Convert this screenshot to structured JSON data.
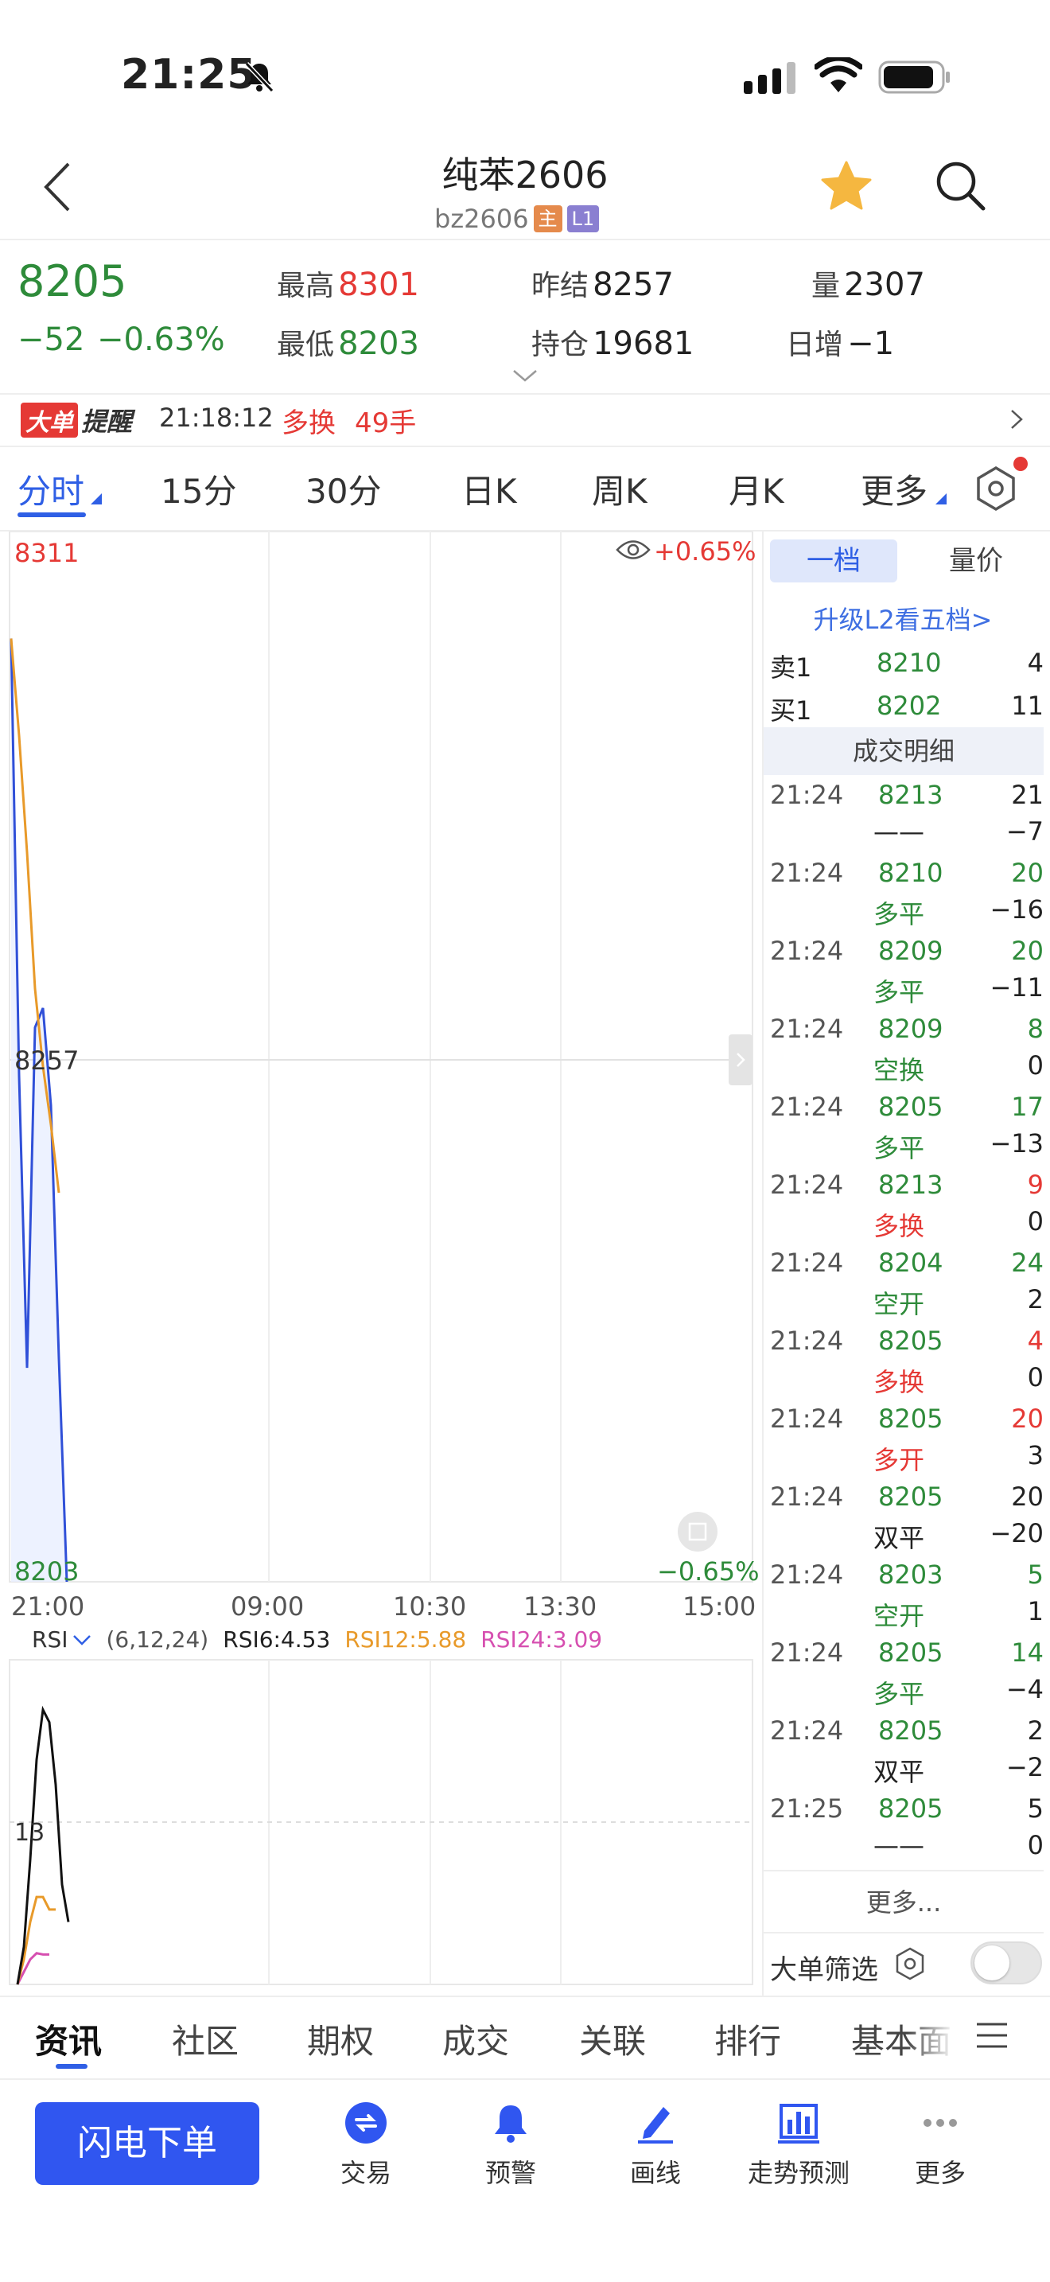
{
  "status_bar": {
    "time": "21:25"
  },
  "header": {
    "title": "纯苯2606",
    "code": "bz2606",
    "tag_main": "主",
    "tag_level": "L1"
  },
  "quote": {
    "last": "8205",
    "change": "−52",
    "change_pct": "−0.63%",
    "high_label": "最高",
    "high": "8301",
    "low_label": "最低",
    "low": "8203",
    "prev_settle_label": "昨结",
    "prev_settle": "8257",
    "open_interest_label": "持仓",
    "open_interest": "19681",
    "volume_label": "量",
    "volume": "2307",
    "daily_inc_label": "日增",
    "daily_inc": "−1"
  },
  "big_order": {
    "badge1": "大单",
    "badge2": "提醒",
    "time": "21:18:12",
    "type": "多换",
    "qty": "49手"
  },
  "period_tabs": [
    "分时",
    "15分",
    "30分",
    "日K",
    "周K",
    "月K",
    "更多"
  ],
  "chart": {
    "high_label": "8311",
    "mid_label": "8257",
    "low_label": "8203",
    "pct_high": "+0.65%",
    "pct_low": "−0.65%",
    "time_labels": [
      "21:00",
      "09:00",
      "10:30",
      "13:30",
      "15:00"
    ],
    "rsi": {
      "name": "RSI",
      "params": "(6,12,24)",
      "rsi6": "RSI6:4.53",
      "rsi12": "RSI12:5.88",
      "rsi24": "RSI24:3.09",
      "mid_label": "13"
    }
  },
  "chart_data": {
    "type": "line",
    "title": "",
    "ylim": [
      8203,
      8311
    ],
    "x_ticks": [
      "21:00",
      "09:00",
      "10:30",
      "13:30",
      "15:00"
    ],
    "series": [
      {
        "name": "price",
        "color": "#3050d8",
        "values": [
          8300,
          8255,
          8225,
          8260,
          8262,
          8252,
          8226,
          8203
        ]
      },
      {
        "name": "avg",
        "color": "#e89a2a",
        "values": [
          8300,
          8290,
          8278,
          8264,
          8256,
          8250,
          8243
        ]
      }
    ],
    "rsi": {
      "colors": {
        "rsi6": "#111111",
        "rsi12": "#e89a2a",
        "rsi24": "#d64fb0"
      },
      "rsi6": [
        0,
        3,
        10,
        18,
        22,
        21,
        16,
        8,
        5
      ],
      "rsi12": [
        0,
        2,
        5,
        7,
        7,
        6,
        6
      ],
      "rsi24": [
        0,
        1,
        2,
        2.5,
        2.4,
        2.4
      ]
    }
  },
  "order_book": {
    "tab1": "一档",
    "tab2": "量价",
    "upgrade": "升级L2看五档>",
    "sell1": {
      "label": "卖1",
      "price": "8210",
      "qty": "4"
    },
    "buy1": {
      "label": "买1",
      "price": "8202",
      "qty": "11"
    },
    "trades_title": "成交明细",
    "trades": [
      {
        "time": "21:24",
        "price": "8213",
        "vol": "21",
        "type": "——",
        "chg": "−7",
        "vol_color": "dark",
        "type_color": "dark"
      },
      {
        "time": "21:24",
        "price": "8210",
        "vol": "20",
        "type": "多平",
        "chg": "−16",
        "vol_color": "green",
        "type_color": "green"
      },
      {
        "time": "21:24",
        "price": "8209",
        "vol": "20",
        "type": "多平",
        "chg": "−11",
        "vol_color": "green",
        "type_color": "green"
      },
      {
        "time": "21:24",
        "price": "8209",
        "vol": "8",
        "type": "空换",
        "chg": "0",
        "vol_color": "green",
        "type_color": "green"
      },
      {
        "time": "21:24",
        "price": "8205",
        "vol": "17",
        "type": "多平",
        "chg": "−13",
        "vol_color": "green",
        "type_color": "green"
      },
      {
        "time": "21:24",
        "price": "8213",
        "vol": "9",
        "type": "多换",
        "chg": "0",
        "vol_color": "red",
        "type_color": "red"
      },
      {
        "time": "21:24",
        "price": "8204",
        "vol": "24",
        "type": "空开",
        "chg": "2",
        "vol_color": "green",
        "type_color": "green"
      },
      {
        "time": "21:24",
        "price": "8205",
        "vol": "4",
        "type": "多换",
        "chg": "0",
        "vol_color": "red",
        "type_color": "red"
      },
      {
        "time": "21:24",
        "price": "8205",
        "vol": "20",
        "type": "多开",
        "chg": "3",
        "vol_color": "red",
        "type_color": "red"
      },
      {
        "time": "21:24",
        "price": "8205",
        "vol": "20",
        "type": "双平",
        "chg": "−20",
        "vol_color": "dark",
        "type_color": "dark"
      },
      {
        "time": "21:24",
        "price": "8203",
        "vol": "5",
        "type": "空开",
        "chg": "1",
        "vol_color": "green",
        "type_color": "green"
      },
      {
        "time": "21:24",
        "price": "8205",
        "vol": "14",
        "type": "多平",
        "chg": "−4",
        "vol_color": "green",
        "type_color": "green"
      },
      {
        "time": "21:24",
        "price": "8205",
        "vol": "2",
        "type": "双平",
        "chg": "−2",
        "vol_color": "dark",
        "type_color": "dark"
      },
      {
        "time": "21:25",
        "price": "8205",
        "vol": "5",
        "type": "——",
        "chg": "0",
        "vol_color": "dark",
        "type_color": "dark"
      }
    ],
    "more": "更多...",
    "filter_label": "大单筛选",
    "filter_on": false
  },
  "info_tabs": [
    "资讯",
    "社区",
    "期权",
    "成交",
    "关联",
    "排行",
    "基本面"
  ],
  "toolbar": {
    "flash_order": "闪电下单",
    "items": [
      {
        "label": "交易",
        "icon": "trade-icon"
      },
      {
        "label": "预警",
        "icon": "bell-icon"
      },
      {
        "label": "画线",
        "icon": "draw-line-icon"
      },
      {
        "label": "走势预测",
        "icon": "forecast-icon"
      },
      {
        "label": "更多",
        "icon": "more-icon"
      }
    ]
  },
  "colors": {
    "accent": "#2f5fe5",
    "up": "#e53935",
    "down": "#2e8b3a"
  }
}
